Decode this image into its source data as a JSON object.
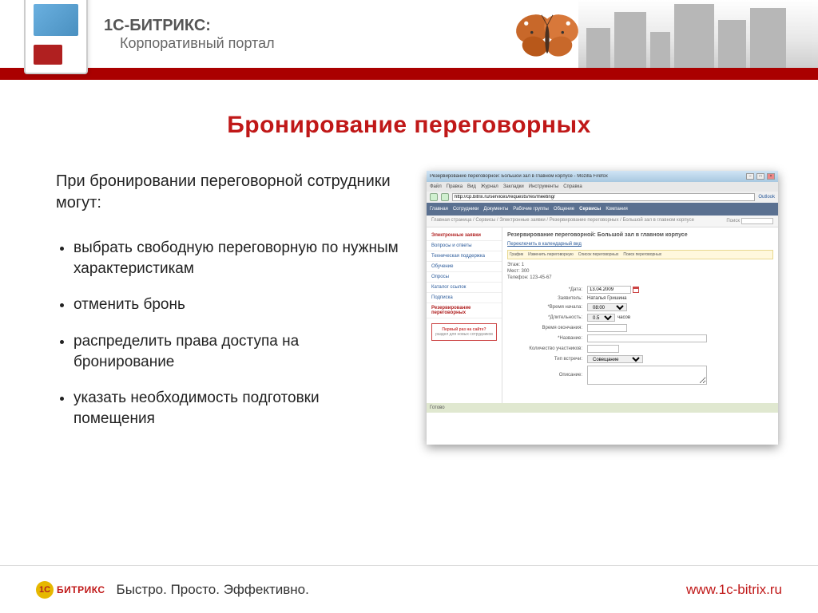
{
  "header": {
    "brand": "1С-БИТРИКС:",
    "subtitle": "Корпоративный портал"
  },
  "slide": {
    "title": "Бронирование переговорных",
    "lead": "При бронировании переговорной сотрудники могут:",
    "bullets": [
      "выбрать свободную переговорную по нужным характеристикам",
      "отменить бронь",
      "распределить права доступа на бронирование",
      "указать необходимость подготовки помещения"
    ]
  },
  "browser": {
    "title": "Резервирование переговорной: Большой зал в главном корпусе - Mozilla Firefox",
    "menu": [
      "Файл",
      "Правка",
      "Вид",
      "Журнал",
      "Закладки",
      "Инструменты",
      "Справка"
    ],
    "url": "http://cp.bitrix.ru/services/requests/res/meeting/",
    "outlook": "Outlook",
    "nav": [
      "Главная",
      "Сотрудники",
      "Документы",
      "Рабочие группы",
      "Общение",
      "Сервисы",
      "Компания"
    ],
    "breadcrumb": "Главная страница / Сервисы / Электронные заявки / Резервирование переговорных / Большой зал в главном корпусе",
    "search_label": "Поиск",
    "sidebar": {
      "items": [
        {
          "label": "Электронные заявки",
          "active": true
        },
        {
          "label": "Вопросы и ответы"
        },
        {
          "label": "Техническая поддержка"
        },
        {
          "label": "Обучение"
        },
        {
          "label": "Опросы"
        },
        {
          "label": "Каталог ссылок"
        },
        {
          "label": "Подписка"
        },
        {
          "label": "Резервирование переговорных",
          "selected": true
        }
      ],
      "promo_title": "Первый раз на сайте?",
      "promo_sub": "раздел для новых сотрудников"
    },
    "main": {
      "title": "Резервирование переговорной: Большой зал в главном корпусе",
      "switch_link": "Переключить в календарный вид",
      "toolbar": [
        "График",
        "Изменить переговорную",
        "Список переговорных",
        "Поиск переговорных"
      ],
      "info": {
        "floor_label": "Этаж:",
        "floor": "1",
        "seats_label": "Мест:",
        "seats": "300",
        "phone_label": "Телефон:",
        "phone": "123-45-67"
      },
      "form": {
        "date_label": "*Дата:",
        "date_value": "13.04.2009",
        "requester_label": "Заявитель:",
        "requester_value": "Наталья Гришина",
        "start_label": "*Время начала:",
        "start_value": "08:00",
        "duration_label": "*Длительность:",
        "duration_value": "0.5",
        "duration_unit": "часов",
        "end_label": "Время окончания:",
        "name_label": "*Название:",
        "participants_label": "Количество участников:",
        "type_label": "Тип встречи:",
        "type_value": "Совещание",
        "desc_label": "Описание:"
      }
    },
    "status": "Готово"
  },
  "footer": {
    "logo_1c": "1С",
    "logo_text": "БИТРИКС",
    "tagline": "Быстро. Просто. Эффективно.",
    "url": "www.1c-bitrix.ru"
  }
}
